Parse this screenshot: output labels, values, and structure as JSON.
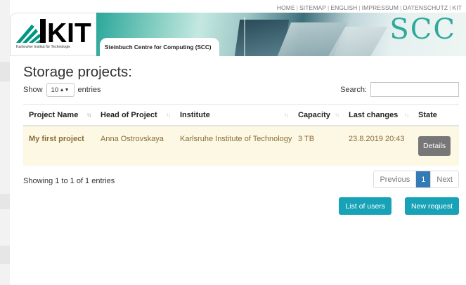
{
  "topnav": {
    "items": [
      "HOME",
      "SITEMAP",
      "ENGLISH",
      "IMPRESSUM",
      "DATENSCHUTZ",
      "KIT"
    ]
  },
  "header": {
    "logo_text": "KIT",
    "logo_subtitle": "Karlsruher Institut für Technologie",
    "scc_name": "Steinbuch Centre for Computing (SCC)",
    "scc_logo": "SCC"
  },
  "page": {
    "title": "Storage projects:"
  },
  "table_controls": {
    "show_label": "Show",
    "entries_label": "entries",
    "page_length": "10",
    "search_label": "Search:",
    "search_value": ""
  },
  "table": {
    "columns": [
      "Project Name",
      "Head of Project",
      "Institute",
      "Capacity",
      "Last changes",
      "State"
    ],
    "rows": [
      {
        "project_name": "My first project",
        "head": "Anna Ostrovskaya",
        "institute": "Karlsruhe Institute of Technology",
        "capacity": "3 TB",
        "last_changes": "23.8.2019 20:43",
        "state_button": "Details"
      }
    ]
  },
  "footer": {
    "info": "Showing 1 to 1 of 1 entries",
    "previous": "Previous",
    "current_page": "1",
    "next": "Next"
  },
  "actions": {
    "list_users": "List of users",
    "new_request": "New request"
  },
  "colors": {
    "accent": "#17a2b8",
    "pagination_active": "#337ab7",
    "row_highlight": "#fcf8e3",
    "row_text": "#8a6d3b",
    "kit_green": "#009682"
  }
}
